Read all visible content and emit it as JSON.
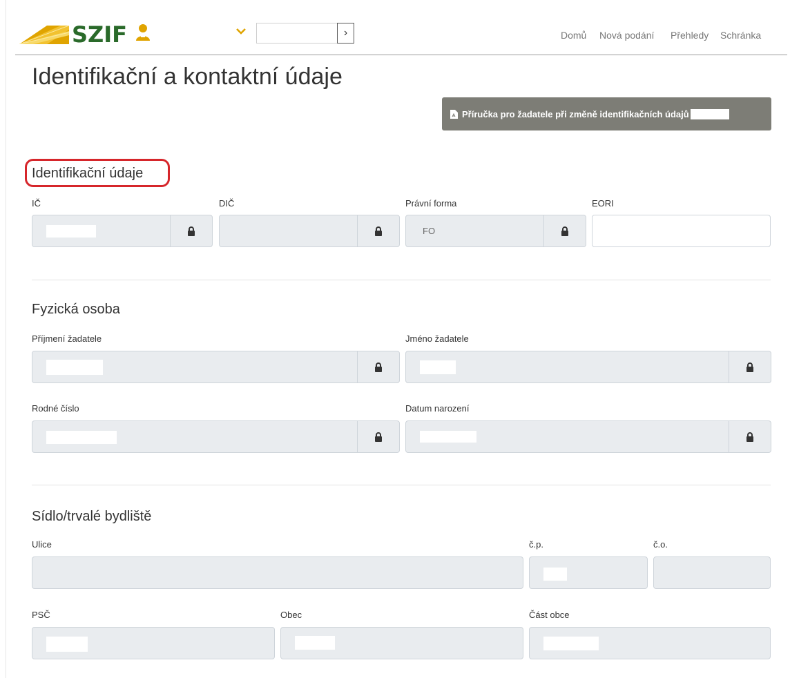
{
  "header": {
    "logo_text": "SZIF",
    "nav": [
      {
        "label": "Domů"
      },
      {
        "label": "Nová podání"
      },
      {
        "label": "Přehledy"
      },
      {
        "label": "Schránka"
      }
    ],
    "go_symbol": "›",
    "brand_color": "#2a6a2a",
    "accent_color": "#e0a400"
  },
  "page": {
    "title": "Identifikační a kontaktní údaje",
    "guide_button_label": "Příručka pro žadatele při změně identifikačních údajů"
  },
  "identification": {
    "section_title": "Identifikační údaje",
    "ic_label": "IČ",
    "dic_label": "DIČ",
    "legal_form_label": "Právní forma",
    "legal_form_value": "FO",
    "eori_label": "EORI"
  },
  "person": {
    "section_title": "Fyzická osoba",
    "surname_label": "Příjmení žadatele",
    "firstname_label": "Jméno žadatele",
    "birth_number_label": "Rodné číslo",
    "birth_date_label": "Datum narození"
  },
  "address": {
    "section_title": "Sídlo/trvalé bydliště",
    "street_label": "Ulice",
    "cp_label": "č.p.",
    "co_label": "č.o.",
    "psc_label": "PSČ",
    "city_label": "Obec",
    "city_part_label": "Část obce"
  },
  "icons": {
    "lock": "lock-icon",
    "pdf": "pdf-icon",
    "user": "user-icon",
    "chevron": "chevron-down-icon"
  },
  "colors": {
    "highlight": "#d6262b",
    "guide_button": "#7d7d76",
    "readonly_field": "#e9ecef"
  }
}
